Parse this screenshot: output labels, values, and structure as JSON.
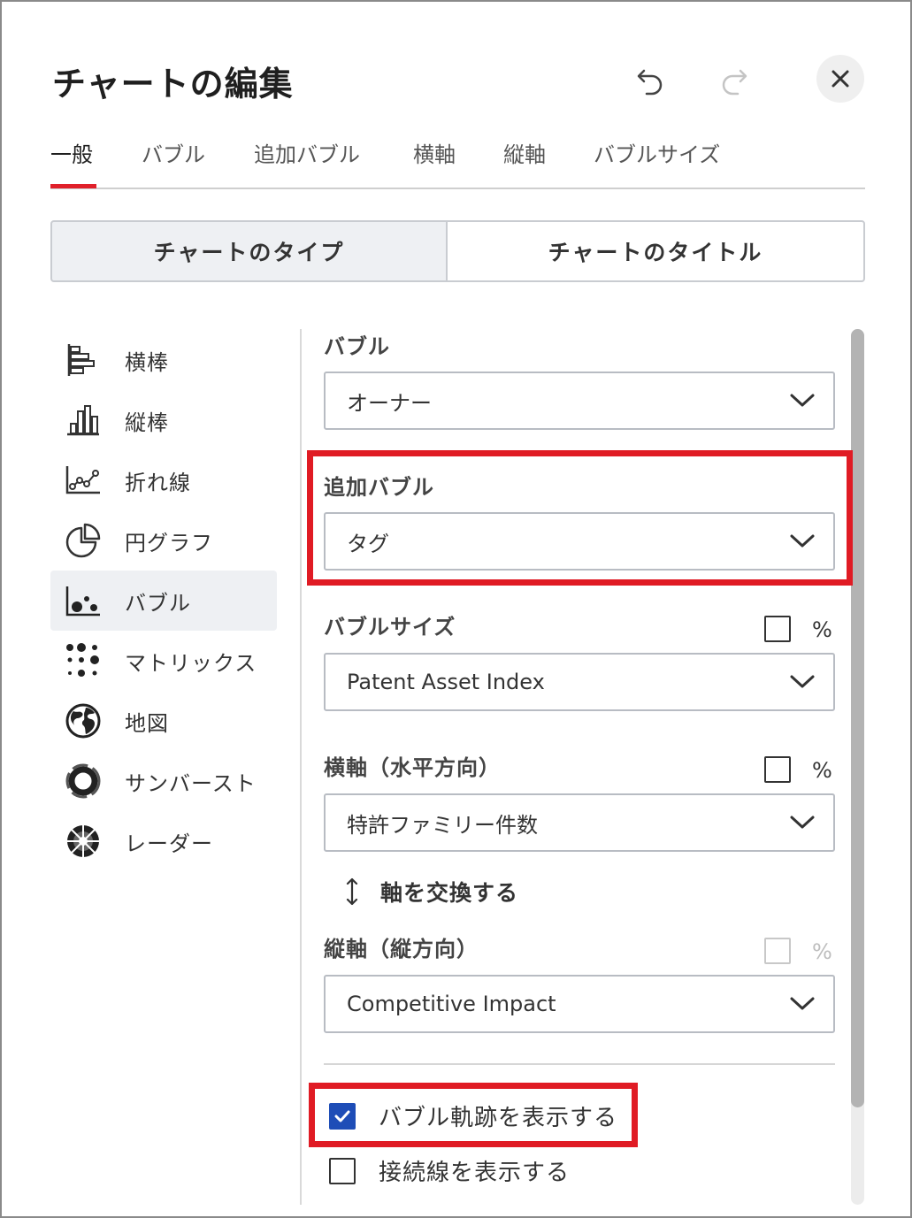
{
  "header": {
    "title": "チャートの編集",
    "undo_icon": "undo-icon",
    "redo_icon": "redo-icon",
    "close_icon": "close-icon"
  },
  "tabs": [
    {
      "label": "一般",
      "active": true
    },
    {
      "label": "バブル"
    },
    {
      "label": "追加バブル"
    },
    {
      "label": "横軸"
    },
    {
      "label": "縦軸"
    },
    {
      "label": "バブルサイズ"
    }
  ],
  "segmented": {
    "chart_type": "チャートのタイプ",
    "chart_title": "チャートのタイトル"
  },
  "chart_types": [
    {
      "label": "横棒",
      "icon": "horizontal-bar-icon"
    },
    {
      "label": "縦棒",
      "icon": "vertical-bar-icon"
    },
    {
      "label": "折れ線",
      "icon": "line-chart-icon"
    },
    {
      "label": "円グラフ",
      "icon": "pie-chart-icon"
    },
    {
      "label": "バブル",
      "icon": "bubble-chart-icon",
      "selected": true
    },
    {
      "label": "マトリックス",
      "icon": "matrix-icon"
    },
    {
      "label": "地図",
      "icon": "globe-icon"
    },
    {
      "label": "サンバースト",
      "icon": "sunburst-icon"
    },
    {
      "label": "レーダー",
      "icon": "radar-icon"
    }
  ],
  "form": {
    "bubble": {
      "label": "バブル",
      "value": "オーナー"
    },
    "extra_bubble": {
      "label": "追加バブル",
      "value": "タグ"
    },
    "bubble_size": {
      "label": "バブルサイズ",
      "value": "Patent Asset Index",
      "percent": "%",
      "percent_checked": false
    },
    "x_axis": {
      "label": "横軸（水平方向）",
      "value": "特許ファミリー件数",
      "percent": "%",
      "percent_checked": false
    },
    "swap": {
      "label": "軸を交換する",
      "icon": "swap-vertical-icon"
    },
    "y_axis": {
      "label": "縦軸（縦方向）",
      "value": "Competitive Impact",
      "percent": "%",
      "percent_disabled": true
    },
    "show_trail": {
      "label": "バブル軌跡を表示する",
      "checked": true
    },
    "show_connector": {
      "label": "接続線を表示する",
      "checked": false
    }
  },
  "colors": {
    "accent_red": "#e0202a",
    "highlight_red": "#e01b24",
    "checkbox_blue": "#1e4db7"
  }
}
